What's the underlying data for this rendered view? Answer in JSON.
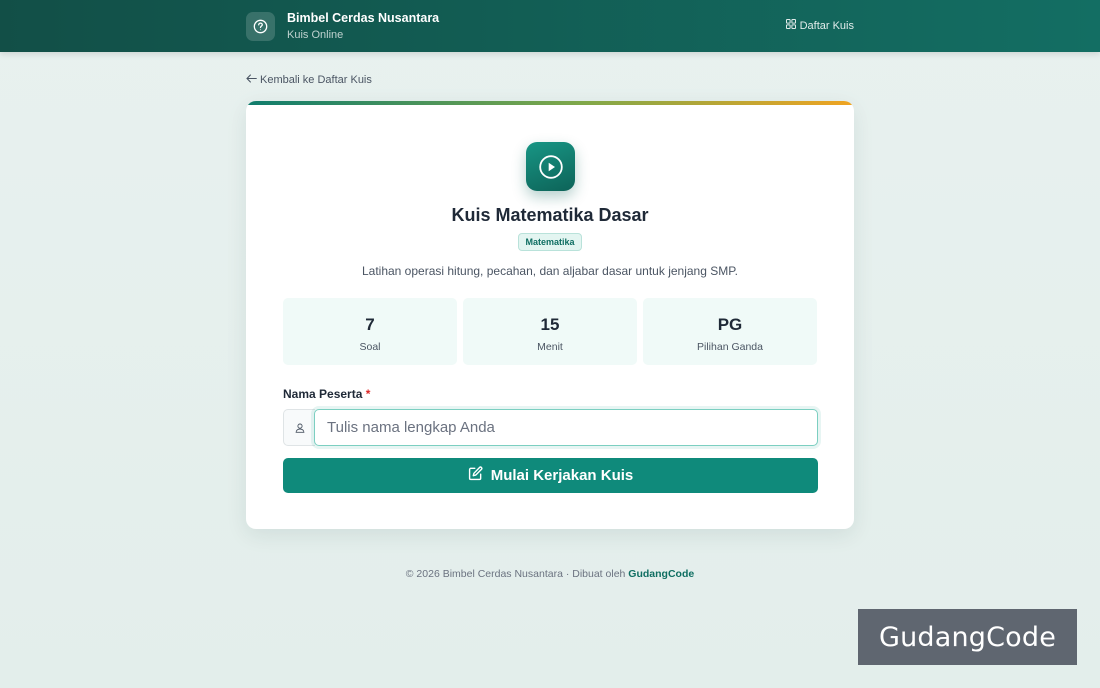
{
  "header": {
    "brand_title": "Bimbel Cerdas Nusantara",
    "brand_subtitle": "Kuis Online",
    "nav_quiz_list": "Daftar Kuis"
  },
  "back_link": "Kembali ke Daftar Kuis",
  "quiz": {
    "title": "Kuis Matematika Dasar",
    "category": "Matematika",
    "description": "Latihan operasi hitung, pecahan, dan aljabar dasar untuk jenjang SMP.",
    "stats": [
      {
        "value": "7",
        "label": "Soal"
      },
      {
        "value": "15",
        "label": "Menit"
      },
      {
        "value": "PG",
        "label": "Pilihan Ganda"
      }
    ]
  },
  "form": {
    "name_label": "Nama Peserta",
    "required_mark": "*",
    "name_placeholder": "Tulis nama lengkap Anda",
    "name_value": "",
    "submit_label": "Mulai Kerjakan Kuis"
  },
  "footer": {
    "text": "© 2026 Bimbel Cerdas Nusantara · Dibuat oleh ",
    "link": "GudangCode"
  },
  "watermark": "GudangCode",
  "colors": {
    "header": "#136e63",
    "accent": "#0f8a7b",
    "badge_bg": "#e3f5f1",
    "stat_bg": "#f0faf8",
    "required": "#dc2626",
    "highlight": "#f0a422"
  },
  "icons": {
    "brand": "question-circle-icon",
    "nav": "grid-icon",
    "back": "arrow-left-icon",
    "quiz": "play-circle-icon",
    "input": "user-icon",
    "submit": "edit-icon"
  }
}
